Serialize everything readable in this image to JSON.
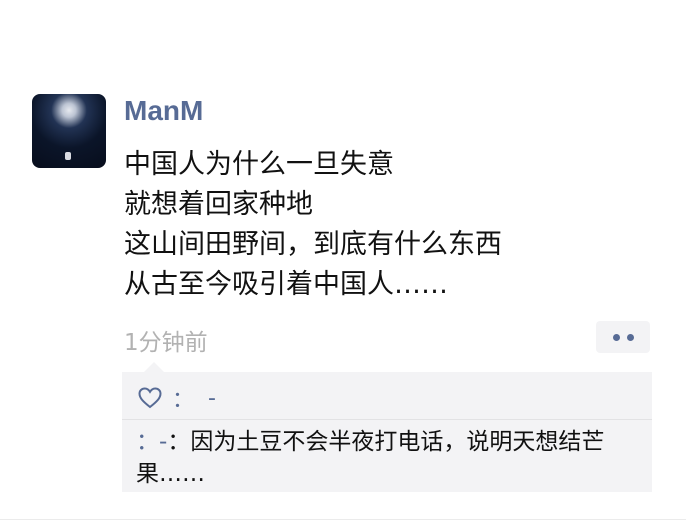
{
  "post": {
    "username": "ManM",
    "lines": [
      "中国人为什么一旦失意",
      "就想着回家种地",
      "这山间田野间，到底有什么东西",
      "从古至今吸引着中国人……"
    ],
    "timestamp": "1分钟前"
  },
  "likes": {
    "icon": "heart-icon",
    "separator": "：",
    "names": "-"
  },
  "comments": [
    {
      "author": "：-",
      "separator": "：",
      "text": "因为土豆不会半夜打电话，说明天想结芒果……"
    }
  ],
  "colors": {
    "link": "#576b95",
    "text": "#111111",
    "muted": "#b2b2b2",
    "panel": "#f3f3f5"
  }
}
